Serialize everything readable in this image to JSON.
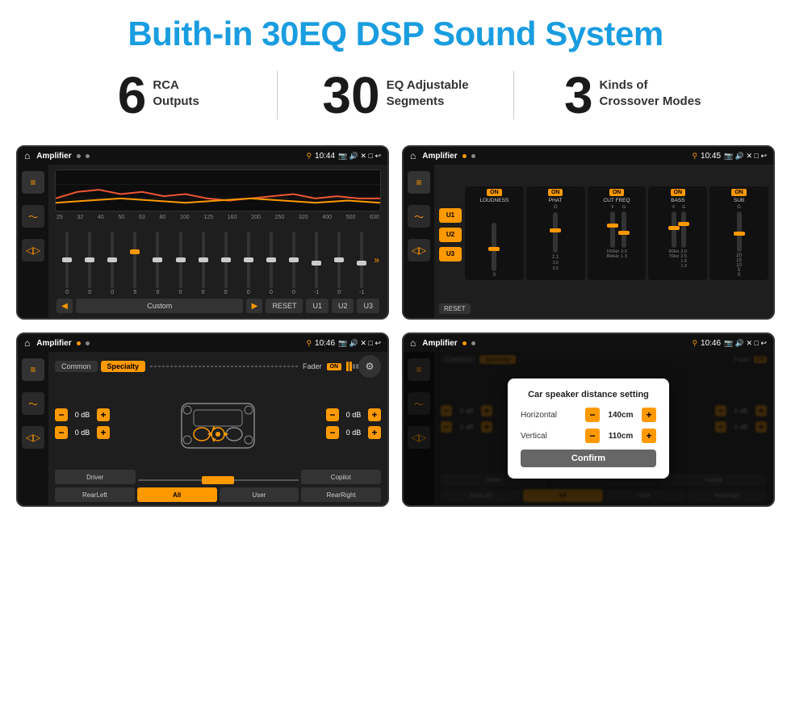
{
  "page": {
    "title": "Buith-in 30EQ DSP Sound System"
  },
  "stats": [
    {
      "number": "6",
      "text": "RCA\nOutputs"
    },
    {
      "number": "30",
      "text": "EQ Adjustable\nSegments"
    },
    {
      "number": "3",
      "text": "Kinds of\nCrossover Modes"
    }
  ],
  "screens": [
    {
      "id": "eq-screen",
      "statusBar": {
        "title": "Amplifier",
        "time": "10:44"
      },
      "type": "equalizer"
    },
    {
      "id": "amp2-screen",
      "statusBar": {
        "title": "Amplifier",
        "time": "10:45"
      },
      "type": "amplifier2"
    },
    {
      "id": "cross-screen",
      "statusBar": {
        "title": "Amplifier",
        "time": "10:46"
      },
      "type": "crossover"
    },
    {
      "id": "dialog-screen",
      "statusBar": {
        "title": "Amplifier",
        "time": "10:46"
      },
      "type": "dialog",
      "dialog": {
        "title": "Car speaker distance setting",
        "horizontal": {
          "label": "Horizontal",
          "value": "140cm"
        },
        "vertical": {
          "label": "Vertical",
          "value": "110cm"
        },
        "confirmLabel": "Confirm"
      }
    }
  ],
  "eq": {
    "frequencies": [
      "25",
      "32",
      "40",
      "50",
      "63",
      "80",
      "100",
      "125",
      "160",
      "200",
      "250",
      "320",
      "400",
      "500",
      "630"
    ],
    "values": [
      "0",
      "0",
      "0",
      "5",
      "0",
      "0",
      "0",
      "0",
      "0",
      "0",
      "0",
      "-1",
      "0",
      "-1"
    ],
    "presets": [
      "Custom"
    ],
    "buttons": [
      "RESET",
      "U1",
      "U2",
      "U3"
    ]
  },
  "amp2": {
    "presets": [
      "U1",
      "U2",
      "U3"
    ],
    "bands": [
      {
        "label": "LOUDNESS",
        "on": true,
        "value": ""
      },
      {
        "label": "PHAT",
        "on": true,
        "value": "G"
      },
      {
        "label": "CUT FREQ",
        "on": true,
        "value": "F G"
      },
      {
        "label": "BASS",
        "on": true,
        "value": "F G"
      },
      {
        "label": "SUB",
        "on": true,
        "value": "G"
      }
    ],
    "resetLabel": "RESET"
  },
  "crossover": {
    "tabs": [
      "Common",
      "Specialty"
    ],
    "activeTab": "Specialty",
    "faderLabel": "Fader",
    "faderOn": "ON",
    "channels": [
      {
        "label": "0 dB"
      },
      {
        "label": "0 dB"
      },
      {
        "label": "0 dB"
      },
      {
        "label": "0 dB"
      }
    ],
    "bottomBtns": [
      "Driver",
      "",
      "",
      "Copilot",
      "RearLeft",
      "All",
      "",
      "User",
      "RearRight"
    ]
  },
  "dialog": {
    "title": "Car speaker distance setting",
    "horizontalLabel": "Horizontal",
    "horizontalValue": "140cm",
    "verticalLabel": "Vertical",
    "verticalValue": "110cm",
    "confirmLabel": "Confirm",
    "dBLabel1": "0 dB",
    "dBLabel2": "0 dB",
    "otherBtns": [
      "Driver",
      "Copilot",
      "RearLeft",
      "All",
      "User",
      "RearRight"
    ]
  }
}
